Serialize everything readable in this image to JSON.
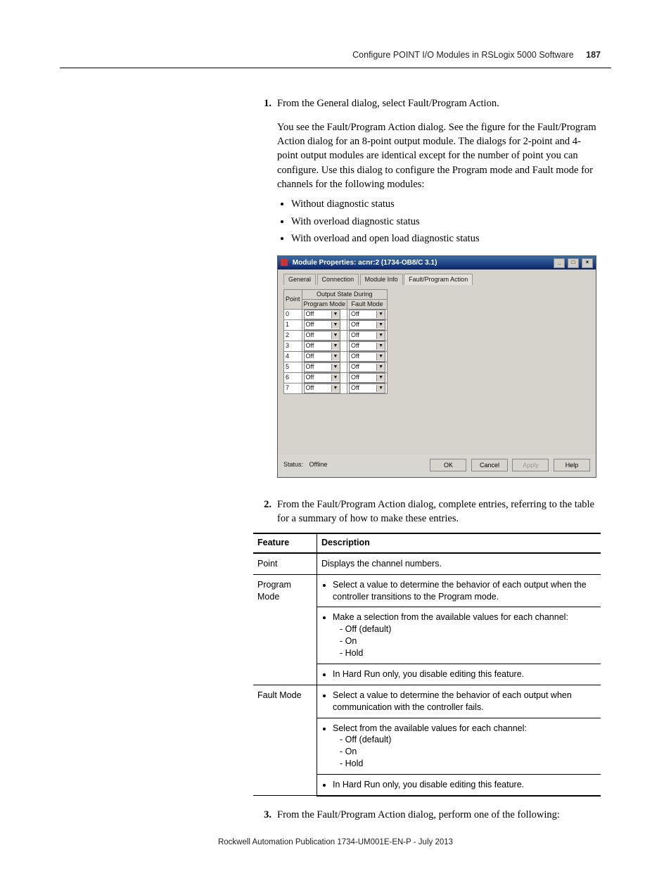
{
  "header": {
    "title": "Configure POINT I/O Modules in RSLogix 5000 Software",
    "page_no": "187"
  },
  "steps": {
    "s1_num": "1.",
    "s1_text": "From the General dialog, select Fault/Program Action.",
    "s1_para": "You see the Fault/Program Action dialog. See the figure for the Fault/Program Action dialog for an 8-point output module. The dialogs for 2-point and 4-point output modules are identical except for the number of point you can configure. Use this dialog to configure the Program mode and Fault mode for channels for the following modules:",
    "b1": "Without diagnostic status",
    "b2": "With overload diagnostic status",
    "b3": "With overload and open load diagnostic status",
    "s2_num": "2.",
    "s2_text": "From the Fault/Program Action dialog, complete entries, referring to the table for a summary of how to make these entries.",
    "s3_num": "3.",
    "s3_text": "From the Fault/Program Action dialog, perform one of the following:"
  },
  "dialog": {
    "title": "Module Properties: acnr:2 (1734-OB8/C 3.1)",
    "tabs": {
      "t1": "General",
      "t2": "Connection",
      "t3": "Module Info",
      "t4": "Fault/Program Action"
    },
    "cols": {
      "point": "Point",
      "group": "Output State During",
      "pm": "Program Mode",
      "fm": "Fault Mode"
    },
    "points": [
      "0",
      "1",
      "2",
      "3",
      "4",
      "5",
      "6",
      "7"
    ],
    "val": "Off",
    "status_label": "Status:",
    "status_value": "Offline",
    "buttons": {
      "ok": "OK",
      "cancel": "Cancel",
      "apply": "Apply",
      "help": "Help"
    }
  },
  "ftable": {
    "h1": "Feature",
    "h2": "Description",
    "r1c1": "Point",
    "r1c2": "Displays the channel numbers.",
    "r2c1": "Program Mode",
    "r2_b1": "Select a value to determine the behavior of each output when the controller transitions to the Program mode.",
    "r2_b2": "Make a selection from the available values for each channel:",
    "r2_s1": "- Off (default)",
    "r2_s2": "- On",
    "r2_s3": "- Hold",
    "r2_b3": "In Hard Run only, you disable editing this feature.",
    "r3c1": "Fault Mode",
    "r3_b1": "Select a value to determine the behavior of each output when communication with the controller fails.",
    "r3_b2": "Select from the available values for each channel:",
    "r3_s1": "- Off (default)",
    "r3_s2": "- On",
    "r3_s3": "- Hold",
    "r3_b3": "In Hard Run only, you disable editing this feature."
  },
  "footer": "Rockwell Automation Publication 1734-UM001E-EN-P - July 2013"
}
